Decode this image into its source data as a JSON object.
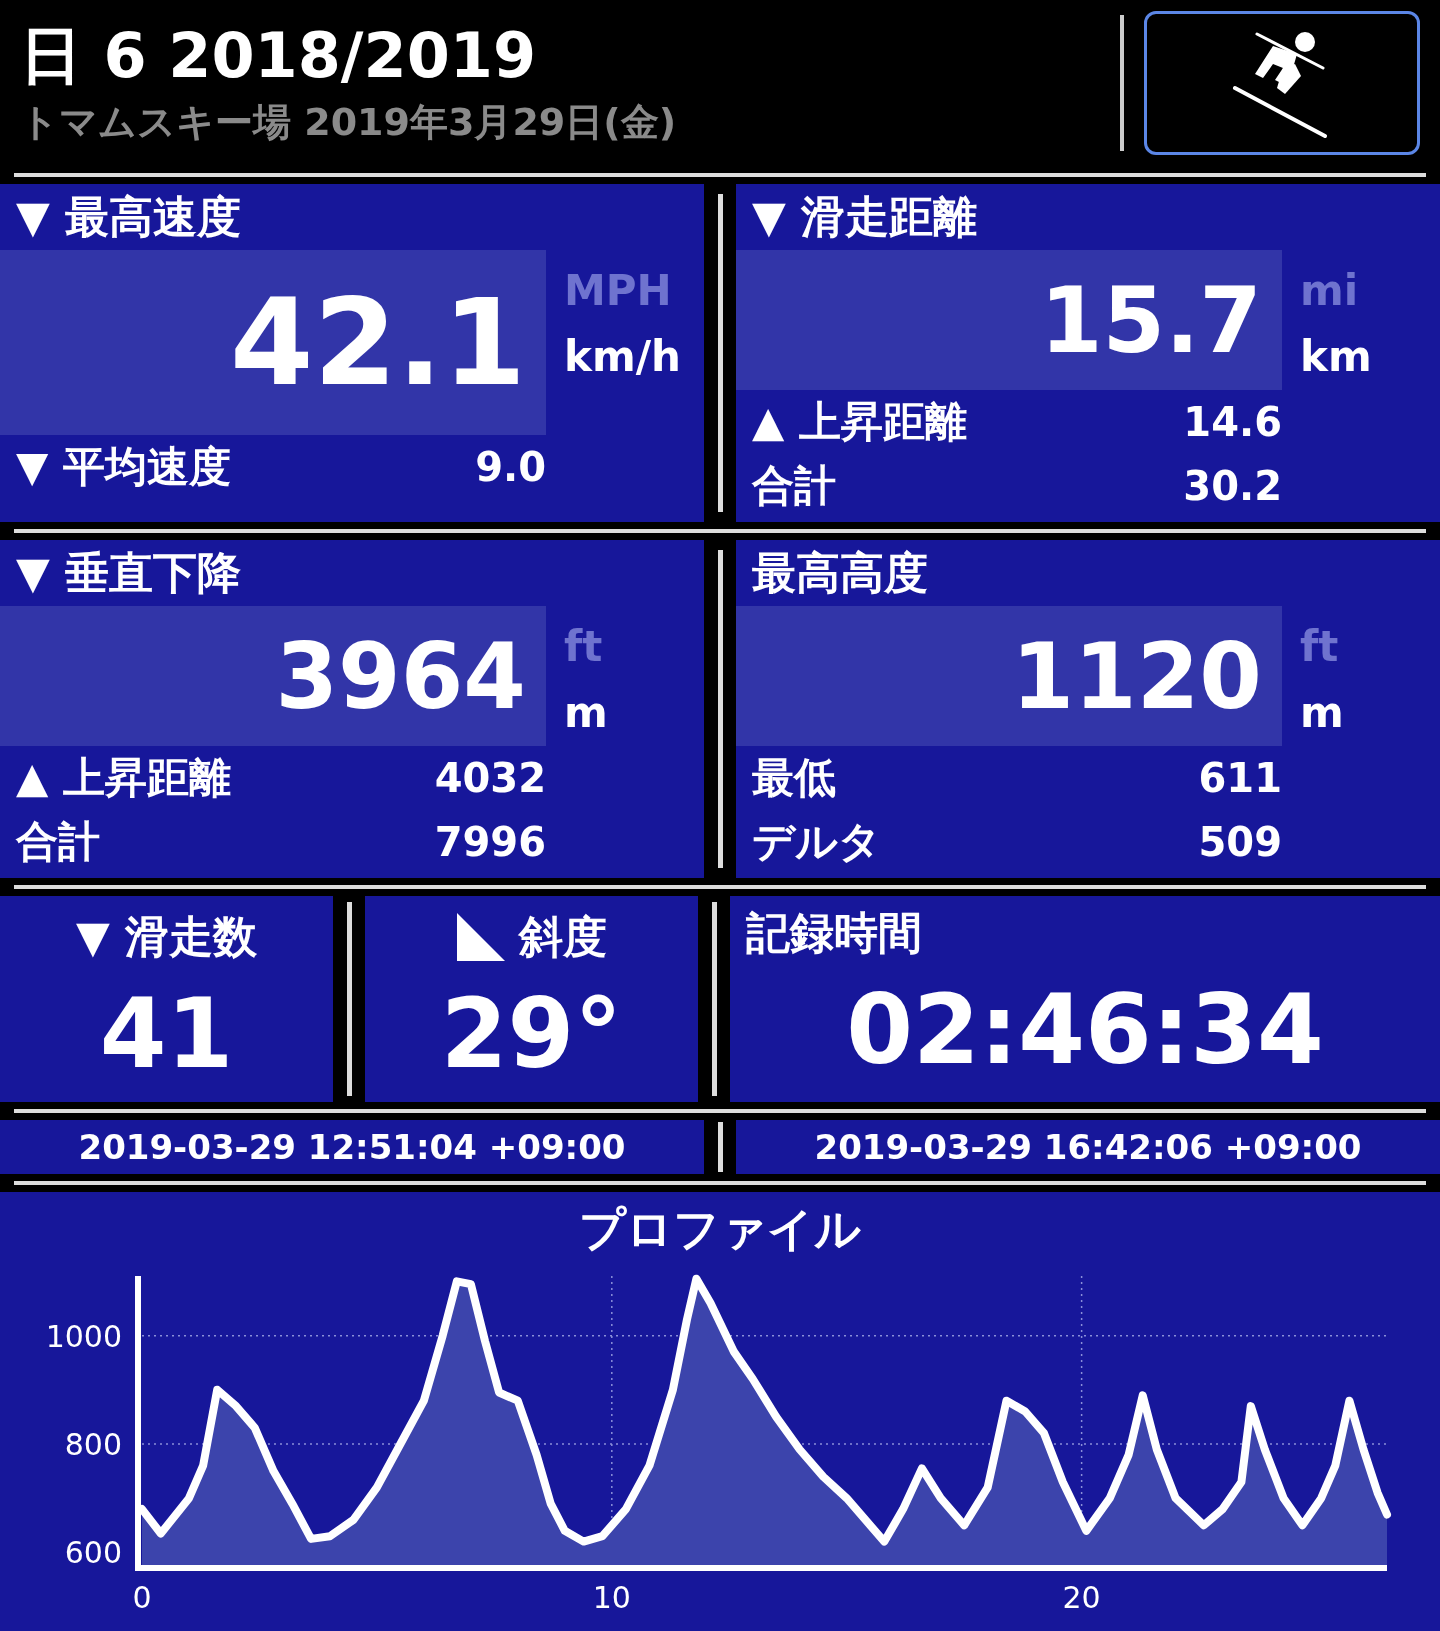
{
  "header": {
    "title": "日 6 2018/2019",
    "subtitle": "トマムスキー場 2019年3月29日(金)"
  },
  "panels": [
    {
      "label": "▼ 最高速度",
      "value": "42.1",
      "units": [
        {
          "label": "MPH",
          "selected": false
        },
        {
          "label": "km/h",
          "selected": true
        }
      ],
      "rows": [
        {
          "label": "▼ 平均速度",
          "value": "9.0"
        }
      ]
    },
    {
      "label": "▼ 滑走距離",
      "value": "15.7",
      "units": [
        {
          "label": "mi",
          "selected": false
        },
        {
          "label": "km",
          "selected": true
        }
      ],
      "rows": [
        {
          "label": "▲ 上昇距離",
          "value": "14.6"
        },
        {
          "label": "合計",
          "value": "30.2"
        }
      ]
    },
    {
      "label": "▼ 垂直下降",
      "value": "3964",
      "units": [
        {
          "label": "ft",
          "selected": false
        },
        {
          "label": "m",
          "selected": true
        }
      ],
      "rows": [
        {
          "label": "▲ 上昇距離",
          "value": "4032"
        },
        {
          "label": "合計",
          "value": "7996"
        }
      ]
    },
    {
      "label": "最高高度",
      "value": "1120",
      "units": [
        {
          "label": "ft",
          "selected": false
        },
        {
          "label": "m",
          "selected": true
        }
      ],
      "rows": [
        {
          "label": "最低",
          "value": "611"
        },
        {
          "label": "デルタ",
          "value": "509"
        }
      ]
    }
  ],
  "counters": [
    {
      "kind": "count",
      "label": "▼ 滑走数",
      "value": "41"
    },
    {
      "kind": "slope",
      "label": "斜度",
      "value": "29°"
    }
  ],
  "record_time": {
    "label": "記録時間",
    "value": "02:46:34"
  },
  "times": [
    "2019-03-29 12:51:04 +09:00",
    "2019-03-29 16:42:06 +09:00"
  ],
  "profile": {
    "chart_data": {
      "type": "area",
      "grid": true,
      "title": "プロファイル",
      "xlim": [
        0,
        26.5
      ],
      "ylim": [
        575,
        1110
      ],
      "xticks": [
        0,
        10,
        20
      ],
      "yticks": [
        600,
        800,
        1000
      ],
      "x": [
        0,
        0.4,
        1.0,
        1.3,
        1.6,
        2.0,
        2.4,
        2.8,
        3.2,
        3.6,
        4.0,
        4.5,
        5.0,
        5.5,
        6.0,
        6.4,
        6.7,
        7.0,
        7.3,
        7.6,
        8.0,
        8.4,
        8.7,
        9.0,
        9.4,
        9.8,
        10.3,
        10.8,
        11.3,
        11.6,
        11.8,
        12.1,
        12.6,
        13.0,
        13.5,
        14.0,
        14.5,
        15.0,
        15.4,
        15.8,
        16.2,
        16.6,
        17.0,
        17.5,
        18.0,
        18.4,
        18.8,
        19.2,
        19.6,
        20.1,
        20.6,
        21.0,
        21.3,
        21.6,
        22.0,
        22.6,
        23.0,
        23.4,
        23.6,
        23.9,
        24.3,
        24.7,
        25.1,
        25.4,
        25.7,
        26.0,
        26.3,
        26.5
      ],
      "series": [
        {
          "color": "#ffffff",
          "values": [
            680,
            635,
            700,
            760,
            900,
            870,
            830,
            750,
            690,
            625,
            630,
            660,
            720,
            800,
            880,
            1000,
            1100,
            1095,
            990,
            895,
            880,
            780,
            690,
            640,
            620,
            630,
            680,
            760,
            900,
            1030,
            1105,
            1060,
            970,
            920,
            850,
            790,
            740,
            700,
            660,
            620,
            680,
            755,
            700,
            650,
            720,
            880,
            860,
            820,
            730,
            640,
            700,
            780,
            890,
            790,
            700,
            650,
            680,
            730,
            870,
            790,
            700,
            650,
            700,
            760,
            880,
            790,
            710,
            670
          ]
        }
      ]
    }
  }
}
